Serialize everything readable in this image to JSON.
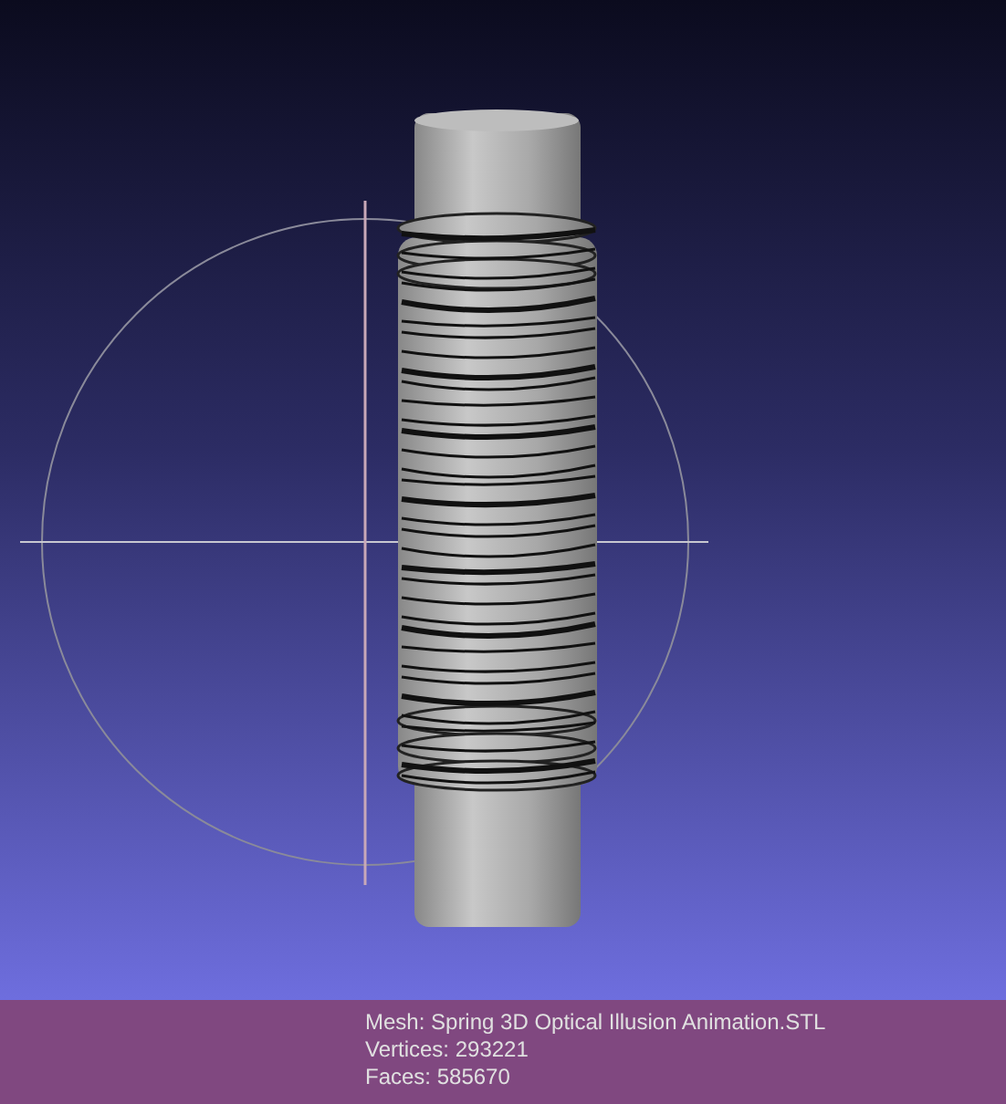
{
  "info_panel": {
    "lines": [
      {
        "text": "Mesh: Spring 3D Optical Illusion Animation.STL"
      },
      {
        "text": "Vertices: 293221"
      },
      {
        "text": "Faces: 585670"
      }
    ]
  }
}
